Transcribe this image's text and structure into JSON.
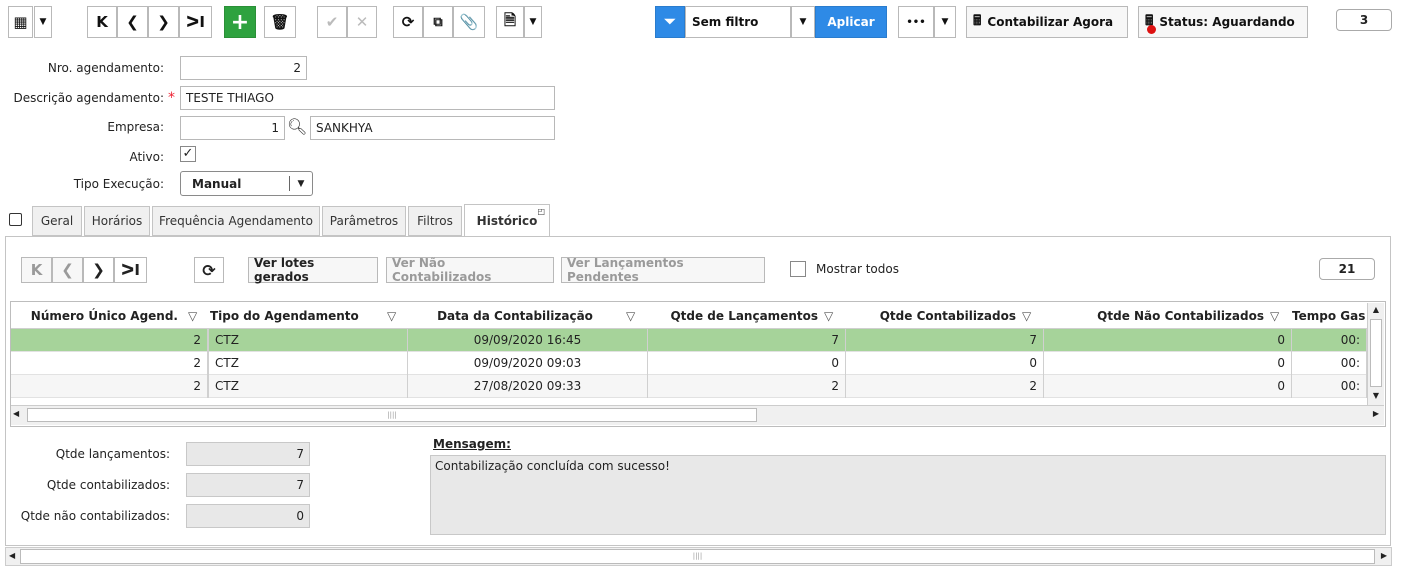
{
  "toolbar": {
    "filter_label": "Sem filtro",
    "apply_label": "Aplicar",
    "more_label": "•••",
    "contabilizar_label": "Contabilizar Agora",
    "status_label": "Status: Aguardando",
    "page_count": "3"
  },
  "form": {
    "nro_label": "Nro. agendamento:",
    "nro_value": "2",
    "descricao_label": "Descrição agendamento:",
    "required_mark": "*",
    "descricao_value": "TESTE THIAGO",
    "empresa_label": "Empresa:",
    "empresa_code": "1",
    "empresa_name": "SANKHYA",
    "ativo_label": "Ativo:",
    "ativo_checked": true,
    "tipo_label": "Tipo Execução:",
    "tipo_value": "Manual"
  },
  "tabs": [
    {
      "label": "Geral"
    },
    {
      "label": "Horários"
    },
    {
      "label": "Frequência Agendamento"
    },
    {
      "label": "Parâmetros"
    },
    {
      "label": "Filtros"
    },
    {
      "label": "Histórico",
      "active": true
    }
  ],
  "subtoolbar": {
    "ver_lotes": "Ver lotes gerados",
    "ver_nao_contab": "Ver Não Contabilizados",
    "ver_pendentes": "Ver Lançamentos Pendentes",
    "mostrar_todos": "Mostrar todos",
    "record_count": "21"
  },
  "grid": {
    "columns": [
      "Número Único Agend.",
      "Tipo do Agendamento",
      "Data da Contabilização",
      "Qtde de Lançamentos",
      "Qtde Contabilizados",
      "Qtde  Não Contabilizados",
      "Tempo Gas"
    ],
    "rows": [
      [
        "2",
        "CTZ",
        "09/09/2020 16:45",
        "7",
        "7",
        "0",
        "00:"
      ],
      [
        "2",
        "CTZ",
        "09/09/2020 09:03",
        "0",
        "0",
        "0",
        "00:"
      ],
      [
        "2",
        "CTZ",
        "27/08/2020 09:33",
        "2",
        "2",
        "0",
        "00:"
      ]
    ]
  },
  "summary": {
    "qtde_lanc_label": "Qtde lançamentos:",
    "qtde_lanc_value": "7",
    "qtde_contab_label": "Qtde contabilizados:",
    "qtde_contab_value": "7",
    "qtde_nao_label": "Qtde não contabilizados:",
    "qtde_nao_value": "0",
    "mensagem_label": "Mensagem:",
    "mensagem_value": "Contabilização concluída com sucesso!"
  },
  "colors": {
    "selected_row": "#a6d39a",
    "accent_blue": "#2e8ae6",
    "add_green": "#2ea23f"
  }
}
